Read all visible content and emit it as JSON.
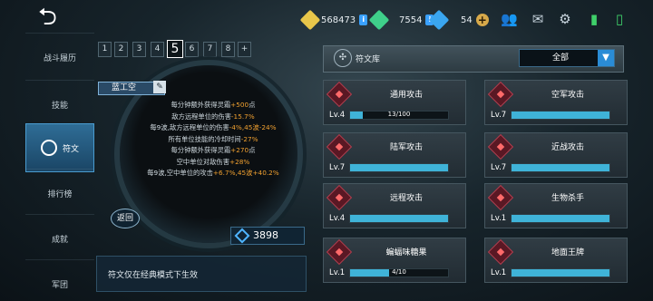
{
  "resources": [
    {
      "name": "gold-crystal",
      "value": "568473",
      "color": "#e8c64a"
    },
    {
      "name": "green-crystal",
      "value": "7554",
      "color": "#3fd08a"
    },
    {
      "name": "blue-crystal",
      "value": "54",
      "color": "#3aa6f0"
    }
  ],
  "menu": [
    {
      "label": "战斗履历",
      "key": "battle-history"
    },
    {
      "label": "技能",
      "key": "skills"
    },
    {
      "label": "符文",
      "key": "runes",
      "active": true
    },
    {
      "label": "排行榜",
      "key": "leaderboard"
    },
    {
      "label": "成就",
      "key": "achievements"
    },
    {
      "label": "军团",
      "key": "legion"
    }
  ],
  "pages": [
    "1",
    "2",
    "3",
    "4",
    "5",
    "6",
    "7",
    "8",
    "+"
  ],
  "rune_set_name": "蓝工空",
  "stats": [
    [
      {
        "t": "每分钟额外获得灵霜"
      },
      {
        "t": "+500",
        "o": true
      },
      {
        "t": "点"
      }
    ],
    [
      {
        "t": "敌方远程单位的伤害"
      },
      {
        "t": "-15.7%",
        "o": true
      }
    ],
    [
      {
        "t": "每9波,敌方远程单位的伤害"
      },
      {
        "t": "-4%,45波-24%",
        "o": true
      }
    ],
    [
      {
        "t": "所有单位技能的冷却时间"
      },
      {
        "t": "-27%",
        "o": true
      }
    ],
    [
      {
        "t": "每分钟额外获得灵霜"
      },
      {
        "t": "+270",
        "o": true
      },
      {
        "t": "点"
      }
    ],
    [
      {
        "t": "空中单位对敌伤害"
      },
      {
        "t": "+28%",
        "o": true
      }
    ],
    [
      {
        "t": "每9波,空中单位的攻击"
      },
      {
        "t": "+6.7%,45波+40.2%",
        "o": true
      }
    ]
  ],
  "back_label": "返回",
  "cost": "3898",
  "note": "符文仅在经典模式下生效",
  "library": {
    "title": "符文库",
    "filter": "全部"
  },
  "cards": [
    {
      "name": "通用攻击",
      "lv": "Lv.4",
      "progress": "13/100",
      "fill": 0.13
    },
    {
      "name": "空军攻击",
      "lv": "Lv.7",
      "progress": "",
      "fill": 1.0
    },
    {
      "name": "陆军攻击",
      "lv": "Lv.7",
      "progress": "",
      "fill": 1.0
    },
    {
      "name": "近战攻击",
      "lv": "Lv.7",
      "progress": "",
      "fill": 1.0
    },
    {
      "name": "远程攻击",
      "lv": "Lv.4",
      "progress": "",
      "fill": 1.0
    },
    {
      "name": "生物杀手",
      "lv": "Lv.1",
      "progress": "",
      "fill": 1.0
    },
    {
      "name": "蝙蝠味糖果",
      "lv": "Lv.1",
      "progress": "4/10",
      "fill": 0.4
    },
    {
      "name": "地面王牌",
      "lv": "Lv.1",
      "progress": "",
      "fill": 1.0
    }
  ]
}
